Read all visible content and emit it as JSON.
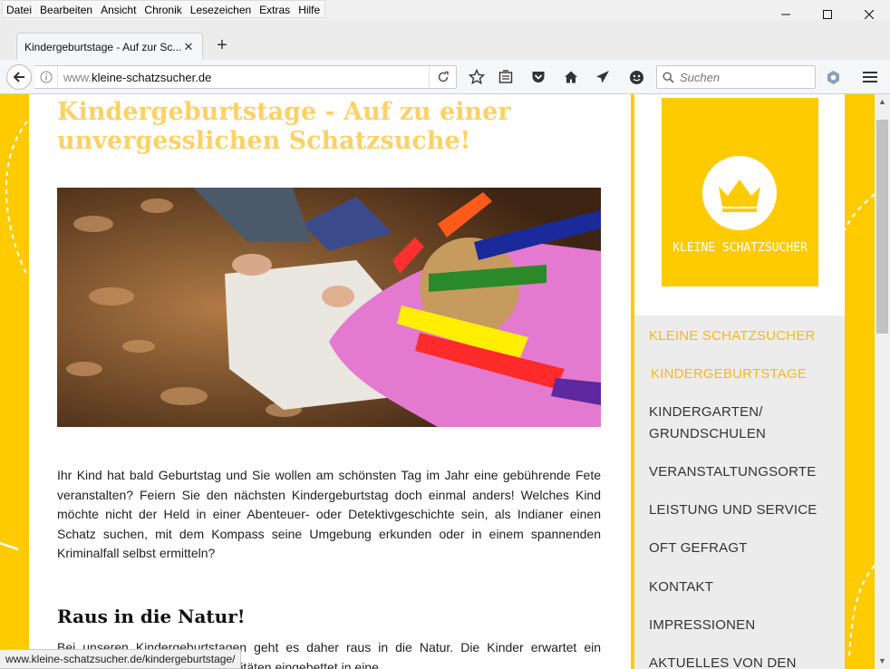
{
  "menubar": {
    "items": [
      "Datei",
      "Bearbeiten",
      "Ansicht",
      "Chronik",
      "Lesezeichen",
      "Extras",
      "Hilfe"
    ]
  },
  "tab": {
    "title": "Kindergeburtstage - Auf zur Sc...",
    "close": "✕",
    "new_tab": "+"
  },
  "navbar": {
    "url_prefix": "www.",
    "url_domain": "kleine-schatzsucher.de",
    "search_placeholder": "Suchen"
  },
  "page": {
    "title": "Kindergeburtstage - Auf zu einer unvergesslichen Schatzsuche!",
    "intro": "Ihr Kind hat bald Geburtstag und Sie wollen am schönsten Tag im Jahr eine gebührende Fete veranstalten? Feiern Sie den nächsten Kindergeburtstag doch einmal anders! Welches Kind möchte nicht der Held in einer Abenteuer- oder Detektivgeschichte sein, als Indianer einen Schatz suchen, mit dem Kompass seine Umgebung erkunden oder in einem spannenden Kriminalfall selbst ermitteln?",
    "section_heading": "Raus in die Natur!",
    "section_text": "Bei unseren Kindergeburtstagen geht es daher raus in die Natur. Die Kinder erwartet ein Programm mit spannenden Aktivitäten eingebettet in eine"
  },
  "sidebar": {
    "logo_text": "KLEINE SCHATZSUCHER",
    "menu": [
      {
        "label": "KLEINE SCHATZSUCHER"
      },
      {
        "label": "KINDERGEBURTSTAGE"
      },
      {
        "label": "KINDERGARTEN/"
      },
      {
        "label": "GRUNDSCHULEN"
      },
      {
        "label": "VERANSTALTUNGSORTE"
      },
      {
        "label": "LEISTUNG UND SERVICE"
      },
      {
        "label": "OFT GEFRAGT"
      },
      {
        "label": "KONTAKT"
      },
      {
        "label": "IMPRESSIONEN"
      },
      {
        "label": "AKTUELLES VON DEN"
      }
    ]
  },
  "status": {
    "url": "www.kleine-schatzsucher.de/kindergeburtstage/"
  },
  "colors": {
    "brand_yellow": "#fecb00",
    "title_yellow": "#fdd167",
    "active_nav": "#f5b91e"
  }
}
